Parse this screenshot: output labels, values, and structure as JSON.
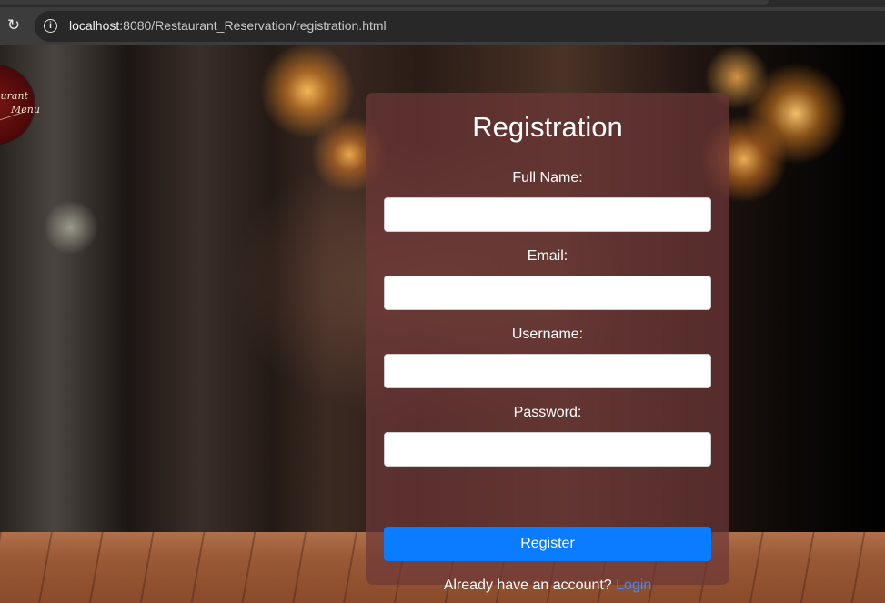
{
  "browser": {
    "url_host": "localhost",
    "url_rest": ":8080/Restaurant_Reservation/registration.html"
  },
  "logo": {
    "line1": "aurant",
    "line2": "Menu"
  },
  "form": {
    "title": "Registration",
    "fields": [
      {
        "label": "Full Name:",
        "value": ""
      },
      {
        "label": "Email:",
        "value": ""
      },
      {
        "label": "Username:",
        "value": ""
      },
      {
        "label": "Password:",
        "value": ""
      }
    ],
    "submit_label": "Register",
    "footer_text": "Already have an account?",
    "login_link": "Login"
  },
  "colors": {
    "button": "#0a7cff",
    "link": "#3b8dff",
    "card": "rgba(110,55,55,0.72)"
  }
}
